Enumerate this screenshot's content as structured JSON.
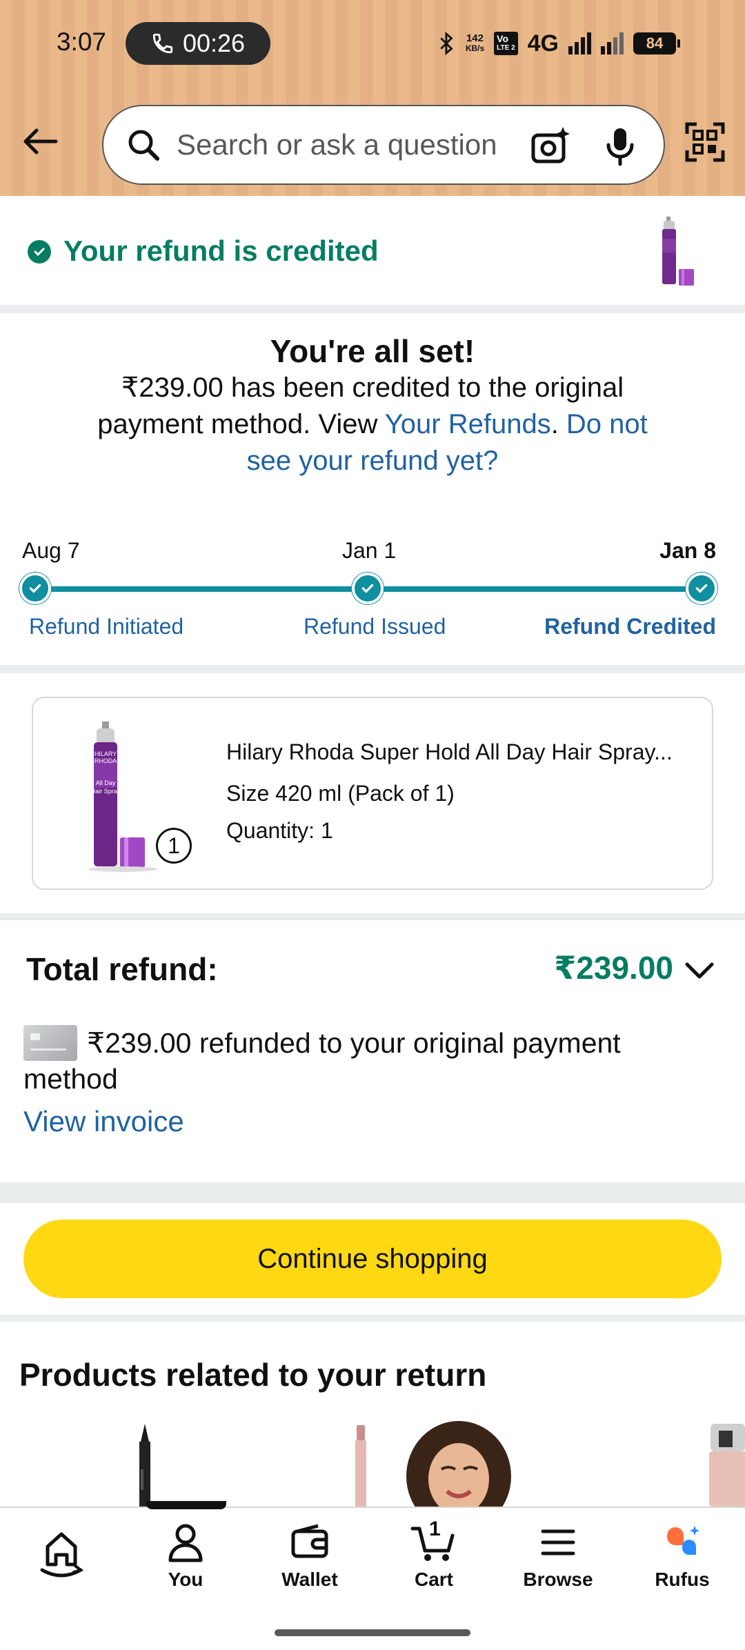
{
  "status_bar": {
    "time": "3:07",
    "call_timer": "00:26",
    "speed_value": "142",
    "speed_unit": "KB/s",
    "volte_top": "Vo",
    "volte_bottom": "LTE 2",
    "network": "4G",
    "battery": "84"
  },
  "header": {
    "search_placeholder": "Search or ask a question",
    "background_color": "#eab98a"
  },
  "refund_banner": {
    "text": "Your refund is credited",
    "color": "#067d62"
  },
  "summary": {
    "title": "You're all set!",
    "body_prefix": "₹239.00 has been credited to the original payment method. View ",
    "your_refunds_link": "Your Refunds",
    "separator": ". ",
    "help_link": "Do not see your refund yet?"
  },
  "timeline": {
    "steps": [
      {
        "date": "Aug 7",
        "label": "Refund Initiated"
      },
      {
        "date": "Jan 1",
        "label": "Refund Issued"
      },
      {
        "date": "Jan 8",
        "label": "Refund Credited"
      }
    ],
    "accent": "#0f8fa0"
  },
  "item": {
    "title": "Hilary Rhoda Super Hold All Day Hair Spray...",
    "size": "Size 420 ml (Pack of 1)",
    "quantity": "Quantity: 1",
    "badge": "1"
  },
  "total": {
    "label": "Total refund:",
    "amount": "₹239.00",
    "refund_line": "₹239.00 refunded to your original payment method",
    "view_invoice": "View invoice"
  },
  "continue_button": "Continue shopping",
  "related": {
    "title": "Products related to your return"
  },
  "bottom_nav": {
    "items": [
      {
        "label": "",
        "icon": "home-icon"
      },
      {
        "label": "You",
        "icon": "person-icon"
      },
      {
        "label": "Wallet",
        "icon": "wallet-icon"
      },
      {
        "label": "Cart",
        "icon": "cart-icon",
        "badge": "1"
      },
      {
        "label": "Browse",
        "icon": "menu-icon"
      },
      {
        "label": "Rufus",
        "icon": "rufus-icon"
      }
    ]
  }
}
